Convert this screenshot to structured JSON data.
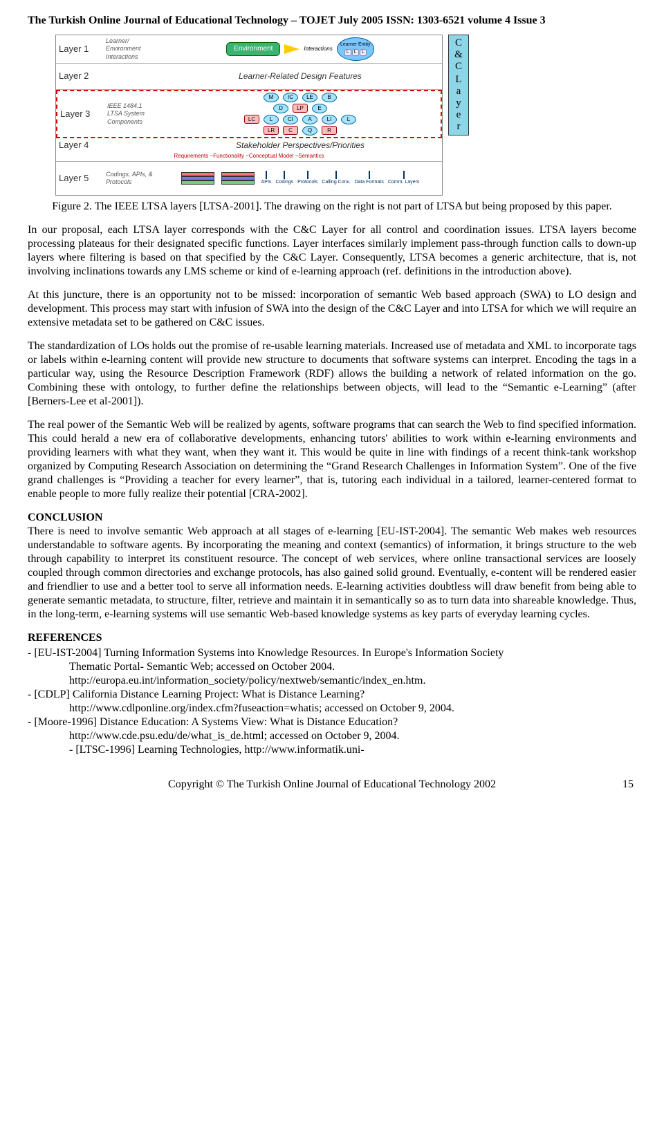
{
  "header": "The Turkish Online Journal of Educational Technology – TOJET July 2005 ISSN: 1303-6521 volume 4 Issue 3",
  "figure": {
    "rows": [
      {
        "layer": "Layer 1",
        "sub": "Learner/ Environment Interactions",
        "env": "Environment",
        "inter": "Interactions",
        "learner": "Learner Entity",
        "mini": [
          "L",
          "L",
          "L"
        ]
      },
      {
        "layer": "Layer 2",
        "sub": "",
        "title": "Learner-Related Design Features"
      },
      {
        "layer": "Layer 3",
        "sub": "IEEE 1484.1 LTSA System Components",
        "top_ov": [
          "M",
          "IC",
          "LE",
          "B"
        ],
        "mid": {
          "ovals_l": [
            "D"
          ],
          "rboxes": [
            "LP"
          ],
          "ovals_r": [
            "E"
          ]
        },
        "line3": [
          "LC",
          "L",
          "CI",
          "A",
          "LI",
          "L"
        ],
        "line4": [
          "LR",
          "C",
          "Q",
          "R"
        ]
      },
      {
        "layer": "Layer 4",
        "sub": "",
        "title": "Stakeholder Perspectives/Priorities",
        "subline": "Requirements ~Functionality ~Conceptual Model ~Semantics"
      },
      {
        "layer": "Layer 5",
        "sub": "Codings, APIs, & Protocols",
        "cols": [
          "APIs",
          "Codings",
          "Protocols",
          "Calling Conv.",
          "Data Formats",
          "Comm. Layers"
        ]
      }
    ],
    "right_band": [
      "C",
      "&",
      "C",
      " ",
      "L",
      "a",
      "y",
      "e",
      "r"
    ]
  },
  "caption": "Figure 2. The IEEE LTSA layers [LTSA-2001]. The drawing on the right is not part of LTSA but being proposed by this paper.",
  "p1": "In our proposal, each LTSA layer corresponds with the C&C Layer for all control and coordination issues. LTSA layers become processing plateaus for their designated specific functions. Layer interfaces similarly implement pass-through function calls to down-up layers where filtering is based on that specified by the C&C Layer. Consequently, LTSA becomes a generic architecture, that is, not involving inclinations towards any LMS scheme or kind of e-learning approach (ref. definitions in the introduction above).",
  "p2": "At this juncture, there is an opportunity not to be missed: incorporation of semantic Web based approach (SWA) to LO design and development. This process may start with infusion of SWA into the design of the C&C Layer and into LTSA for which we will require an extensive metadata set to be gathered on C&C issues.",
  "p3": "The standardization of LOs holds out the promise of re-usable learning materials. Increased use of metadata and XML to incorporate tags or labels within e-learning content will provide new structure to documents that software systems can interpret. Encoding the tags in a particular way, using the Resource Description Framework (RDF) allows the building a network of related information on the go. Combining these with ontology, to further define the relationships between objects, will lead to the “Semantic e-Learning” (after [Berners-Lee et al-2001]).",
  "p4": "The real power of the Semantic Web will be realized by agents, software programs that can search the Web to find specified information. This could herald a new era of collaborative developments, enhancing tutors' abilities to work within e-learning environments and providing learners with what they want, when they want it. This would be quite in line with findings of a recent think-tank workshop organized by Computing Research Association on determining the “Grand Research Challenges in Information System”. One of the five grand challenges is “Providing a teacher for every learner”, that is, tutoring each individual in a tailored, learner-centered format to enable people to more fully realize their potential [CRA-2002].",
  "conclusion_head": "CONCLUSION",
  "p5": "There is need to involve semantic Web approach at all stages of e-learning [EU-IST-2004]. The semantic Web makes web resources understandable to software agents. By incorporating the meaning and context (semantics) of information, it brings structure to the web through capability to interpret its constituent resource. The concept of web services, where online transactional services are loosely coupled through common directories and exchange protocols, has also gained solid ground. Eventually, e-content will be rendered easier and friendlier to use and a better tool to serve all information needs. E-learning activities doubtless will draw benefit from being able to generate semantic metadata, to structure, filter, retrieve and maintain it in semantically so as to turn data into shareable knowledge. Thus, in the long-term, e-learning systems will use semantic Web-based knowledge systems as key parts of everyday learning cycles.",
  "refs_head": "REFERENCES",
  "refs": [
    "- [EU-IST-2004] Turning Information Systems into Knowledge Resources. In Europe's Information Society",
    "Thematic Portal- Semantic Web; accessed on October 2004.",
    "http://europa.eu.int/information_society/policy/nextweb/semantic/index_en.htm.",
    "- [CDLP] California Distance Learning Project: What is Distance Learning?",
    "http://www.cdlponline.org/index.cfm?fuseaction=whatis; accessed on October 9, 2004.",
    "- [Moore-1996] Distance Education: A Systems View: What is Distance Education?",
    "http://www.cde.psu.edu/de/what_is_de.html; accessed on October 9, 2004.",
    "- [LTSC-1996] Learning Technologies, http://www.informatik.uni-"
  ],
  "refs_indent": [
    false,
    true,
    true,
    false,
    true,
    false,
    true,
    true
  ],
  "footer": {
    "copy": "Copyright © The Turkish Online Journal of Educational Technology 2002",
    "page": "15"
  }
}
